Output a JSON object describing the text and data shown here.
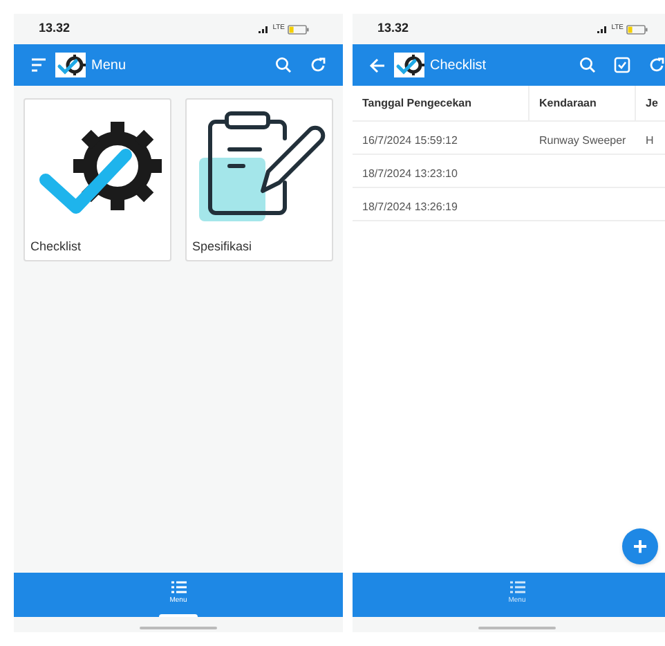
{
  "screens": [
    {
      "kind": "menu",
      "status_bar": {
        "time": "13.32",
        "network": "LTE"
      },
      "header": {
        "nav": {
          "kind": "menu"
        },
        "title": "Menu",
        "actions": [
          {
            "kind": "search"
          },
          {
            "kind": "refresh"
          }
        ]
      },
      "tiles": [
        {
          "label": "Checklist",
          "kind": "checklist"
        },
        {
          "label": "Spesifikasi",
          "kind": "spec"
        }
      ],
      "bottom_nav": [
        {
          "label": "Menu",
          "selected": true
        }
      ]
    },
    {
      "kind": "table",
      "status_bar": {
        "time": "13.32",
        "network": "LTE"
      },
      "header": {
        "nav": {
          "kind": "back"
        },
        "title": "Checklist",
        "actions": [
          {
            "kind": "search"
          },
          {
            "kind": "select"
          },
          {
            "kind": "refresh"
          }
        ]
      },
      "table": {
        "columns": [
          "Tanggal Pengecekan",
          "Kendaraan",
          "Je"
        ],
        "rows": [
          [
            "16/7/2024 15:59:12",
            "Runway Sweeper",
            "H"
          ],
          [
            "18/7/2024 13:23:10",
            "",
            ""
          ],
          [
            "18/7/2024 13:26:19",
            "",
            ""
          ]
        ]
      },
      "fab": {
        "label": "+"
      },
      "bottom_nav": [
        {
          "label": "Menu",
          "selected": false
        }
      ]
    }
  ]
}
